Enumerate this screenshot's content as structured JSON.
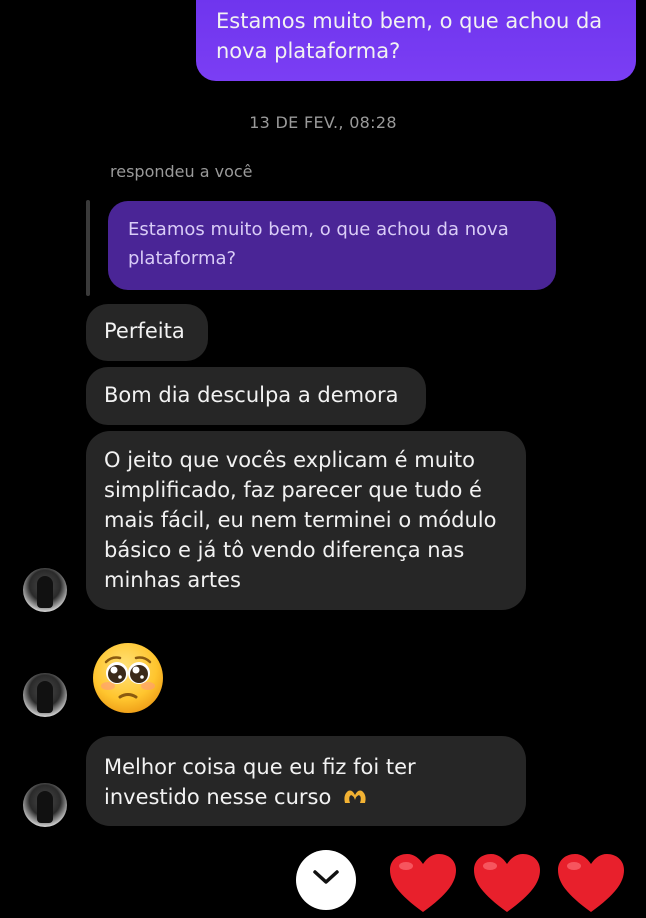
{
  "messages": {
    "outgoing_1": "Estamos muito bem, o que achou da nova plataforma?",
    "timestamp": "13 DE FEV., 08:28",
    "reply_label": "respondeu a você",
    "quoted": "Estamos muito bem, o que achou da nova plataforma?",
    "incoming": [
      "Perfeita",
      "Bom dia desculpa a demora",
      "O jeito que vocês explicam é muito simplificado, faz parecer que tudo é mais fácil, eu nem terminei o módulo básico e já tô vendo diferença nas minhas artes",
      "Melhor coisa que eu fiz foi ter investido nesse curso"
    ],
    "emoji": "pleading-face-icon",
    "inline_emoji": "heart-hands-icon"
  },
  "reactions": [
    "heart-icon",
    "heart-icon",
    "heart-icon"
  ],
  "colors": {
    "background": "#000000",
    "outgoing_bubble": "#7a3df5",
    "incoming_bubble": "#262626",
    "quoted_bubble": "#4a2596",
    "heart": "#e8202c"
  }
}
